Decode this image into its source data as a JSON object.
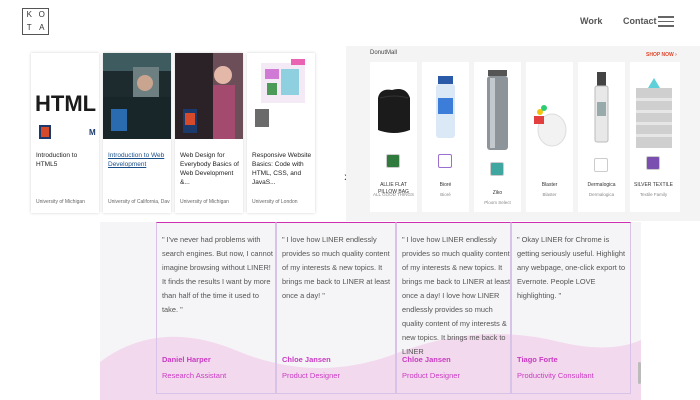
{
  "header": {
    "logo_letters": [
      "K",
      "O",
      "T",
      "A"
    ],
    "nav": {
      "work": "Work",
      "contact": "Contact"
    }
  },
  "courses": [
    {
      "title": "Introduction to HTML5",
      "university": "University of Michigan",
      "link": false
    },
    {
      "title": "Introduction to Web Development",
      "university": "University of California, Davis",
      "link": true
    },
    {
      "title": "Web Design for Everybody Basics of Web Development &...",
      "university": "University of Michigan",
      "link": false
    },
    {
      "title": "Responsive Website Basics: Code with HTML, CSS, and JavaS...",
      "university": "University of London",
      "link": false
    }
  ],
  "products_panel": {
    "store_label": "DonutMall",
    "shop_now": "SHOP NOW ›",
    "items": [
      {
        "name": "ALLIE FLAT PILLOW BAG",
        "brand": "ALL GOOD THINGS"
      },
      {
        "name": "Bioré",
        "brand": "Bioré"
      },
      {
        "name": "Ziko",
        "brand": "Ploom Select"
      },
      {
        "name": "Blaster",
        "brand": "Blaster"
      },
      {
        "name": "Dermalogica",
        "brand": "Dermalogica"
      },
      {
        "name": "SILVER TEXTILE",
        "brand": "Textile Family"
      }
    ]
  },
  "testimonials": [
    {
      "quote": "\" I've never had problems with search engines. But now, I cannot imagine browsing without LINER! It finds the results I want by more than half of the time it used to take. \"",
      "name": "Daniel Harper",
      "role": "Research Assistant"
    },
    {
      "quote": "\" I love how LINER endlessly provides so much quality content of my interests & new topics. It brings me back to LINER at least once a day! \"",
      "name": "Chloe Jansen",
      "role": "Product Designer"
    },
    {
      "quote": "\" I love how LINER endlessly provides so much quality content of my interests & new topics. It brings me back to LINER at least once a day! I love how LINER endlessly provides so much quality content of my interests & new topics. It brings me back to LINER",
      "name": "Chloe Jansen",
      "role": "Product Designer"
    },
    {
      "quote": "\" Okay LINER for Chrome is getting seriously useful. Highlight any webpage, one-click export to Evernote. People LOVE highlighting. \"",
      "name": "Tiago Forte",
      "role": "Productivity Consultant"
    }
  ],
  "colors": {
    "accent_pink": "#c93ac2",
    "card_border_top": "#cc2fb0",
    "wave": "#f1d6ee",
    "shop_now": "#e0462b"
  }
}
